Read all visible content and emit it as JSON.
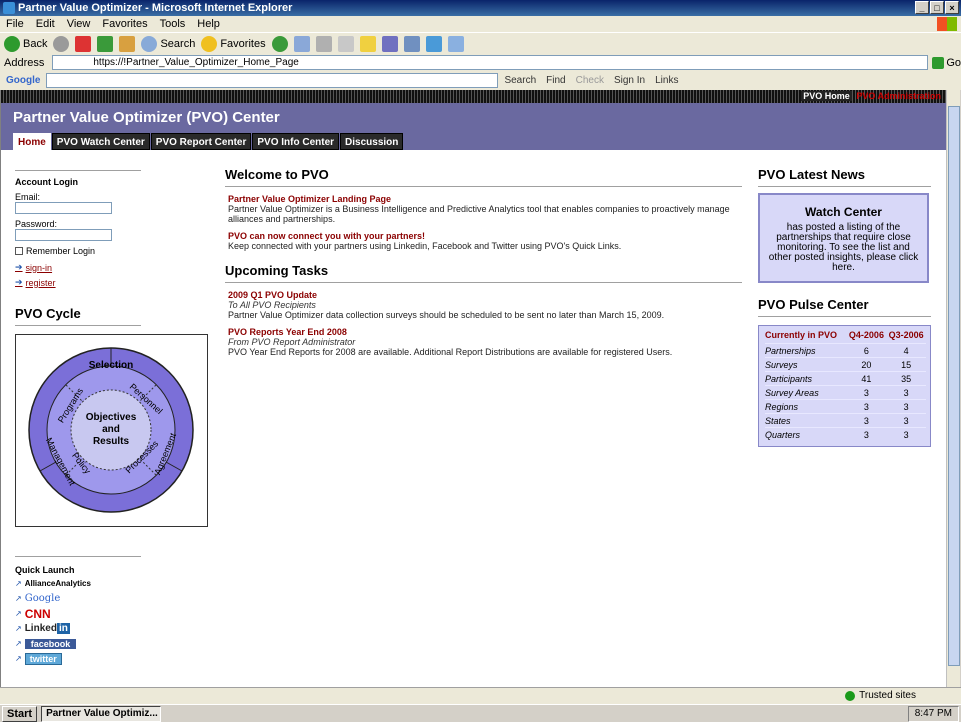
{
  "window": {
    "title": "Partner Value Optimizer - Microsoft Internet Explorer",
    "controls": [
      "_",
      "×"
    ]
  },
  "menu": [
    "File",
    "Edit",
    "View",
    "Favorites",
    "Tools",
    "Help"
  ],
  "toolbar": {
    "back": "Back",
    "search": "Search",
    "favorites": "Favorites"
  },
  "address": {
    "label": "Address",
    "url": "https://!Partner_Value_Optimizer_Home_Page",
    "go": "Go"
  },
  "googlebar": {
    "logo": "Google",
    "search": "Search",
    "find": "Find",
    "check": "Check",
    "signin": "Sign In",
    "links": "Links"
  },
  "page": {
    "top_links": {
      "home": "PVO Home",
      "other": "PVO Administration"
    },
    "header_title": "Partner Value Optimizer (PVO) Center",
    "tabs": [
      {
        "label": "Home",
        "active": true
      },
      {
        "label": "PVO Watch Center"
      },
      {
        "label": "PVO Report Center"
      },
      {
        "label": "PVO Info Center"
      },
      {
        "label": "Discussion"
      }
    ],
    "login": {
      "title": "Account Login",
      "email_label": "Email:",
      "password_label": "Password:",
      "remember": "Remember Login",
      "signin": "sign-in",
      "register": "register"
    },
    "cycle": {
      "title": "PVO Cycle",
      "center": [
        "Objectives",
        "and",
        "Results"
      ],
      "inner": [
        "Programs",
        "Personnel",
        "Policy",
        "Processes"
      ],
      "outer": [
        "Selection",
        "Management",
        "Agreement"
      ]
    },
    "quick_launch": {
      "title": "Quick Launch",
      "items": [
        "AllianceAnalytics",
        "Google",
        "CNN",
        "Linked",
        "in",
        "facebook",
        "twitter"
      ]
    },
    "welcome": {
      "title": "Welcome to PVO",
      "items": [
        {
          "title": "Partner Value Optimizer Landing Page",
          "desc": "Partner Value Optimizer is a Business Intelligence and Predictive Analytics tool that enables companies to proactively manage alliances and partnerships."
        },
        {
          "title": "PVO can now connect you with your partners!",
          "desc": "Keep connected with your partners using Linkedin, Facebook and Twitter using PVO's Quick Links."
        }
      ]
    },
    "tasks": {
      "title": "Upcoming Tasks",
      "items": [
        {
          "title": "2009 Q1 PVO Update",
          "sub": "To All PVO Recipients",
          "desc": "Partner Value Optimizer data collection surveys should be scheduled to be sent no later than March 15, 2009."
        },
        {
          "title": "PVO Reports Year End 2008",
          "sub": "From PVO Report Administrator",
          "desc": "PVO Year End Reports for 2008 are available. Additional Report Distributions are available for registered Users."
        }
      ]
    },
    "news": {
      "title": "PVO Latest News",
      "watch_title": "Watch Center",
      "watch_desc": "has posted a listing of the partnerships that require close monitoring. To see the list and other posted insights, please click here."
    },
    "pulse": {
      "title": "PVO Pulse Center",
      "header": [
        "Currently in PVO",
        "Q4-2006",
        "Q3-2006"
      ],
      "rows": [
        [
          "Partnerships",
          "6",
          "4"
        ],
        [
          "Surveys",
          "20",
          "15"
        ],
        [
          "Participants",
          "41",
          "35"
        ],
        [
          "Survey Areas",
          "3",
          "3"
        ],
        [
          "Regions",
          "3",
          "3"
        ],
        [
          "States",
          "3",
          "3"
        ],
        [
          "Quarters",
          "3",
          "3"
        ]
      ]
    }
  },
  "status": {
    "zone": "Trusted sites"
  },
  "taskbar": {
    "start": "Start",
    "task": "Partner Value Optimiz...",
    "clock": "8:47 PM"
  }
}
